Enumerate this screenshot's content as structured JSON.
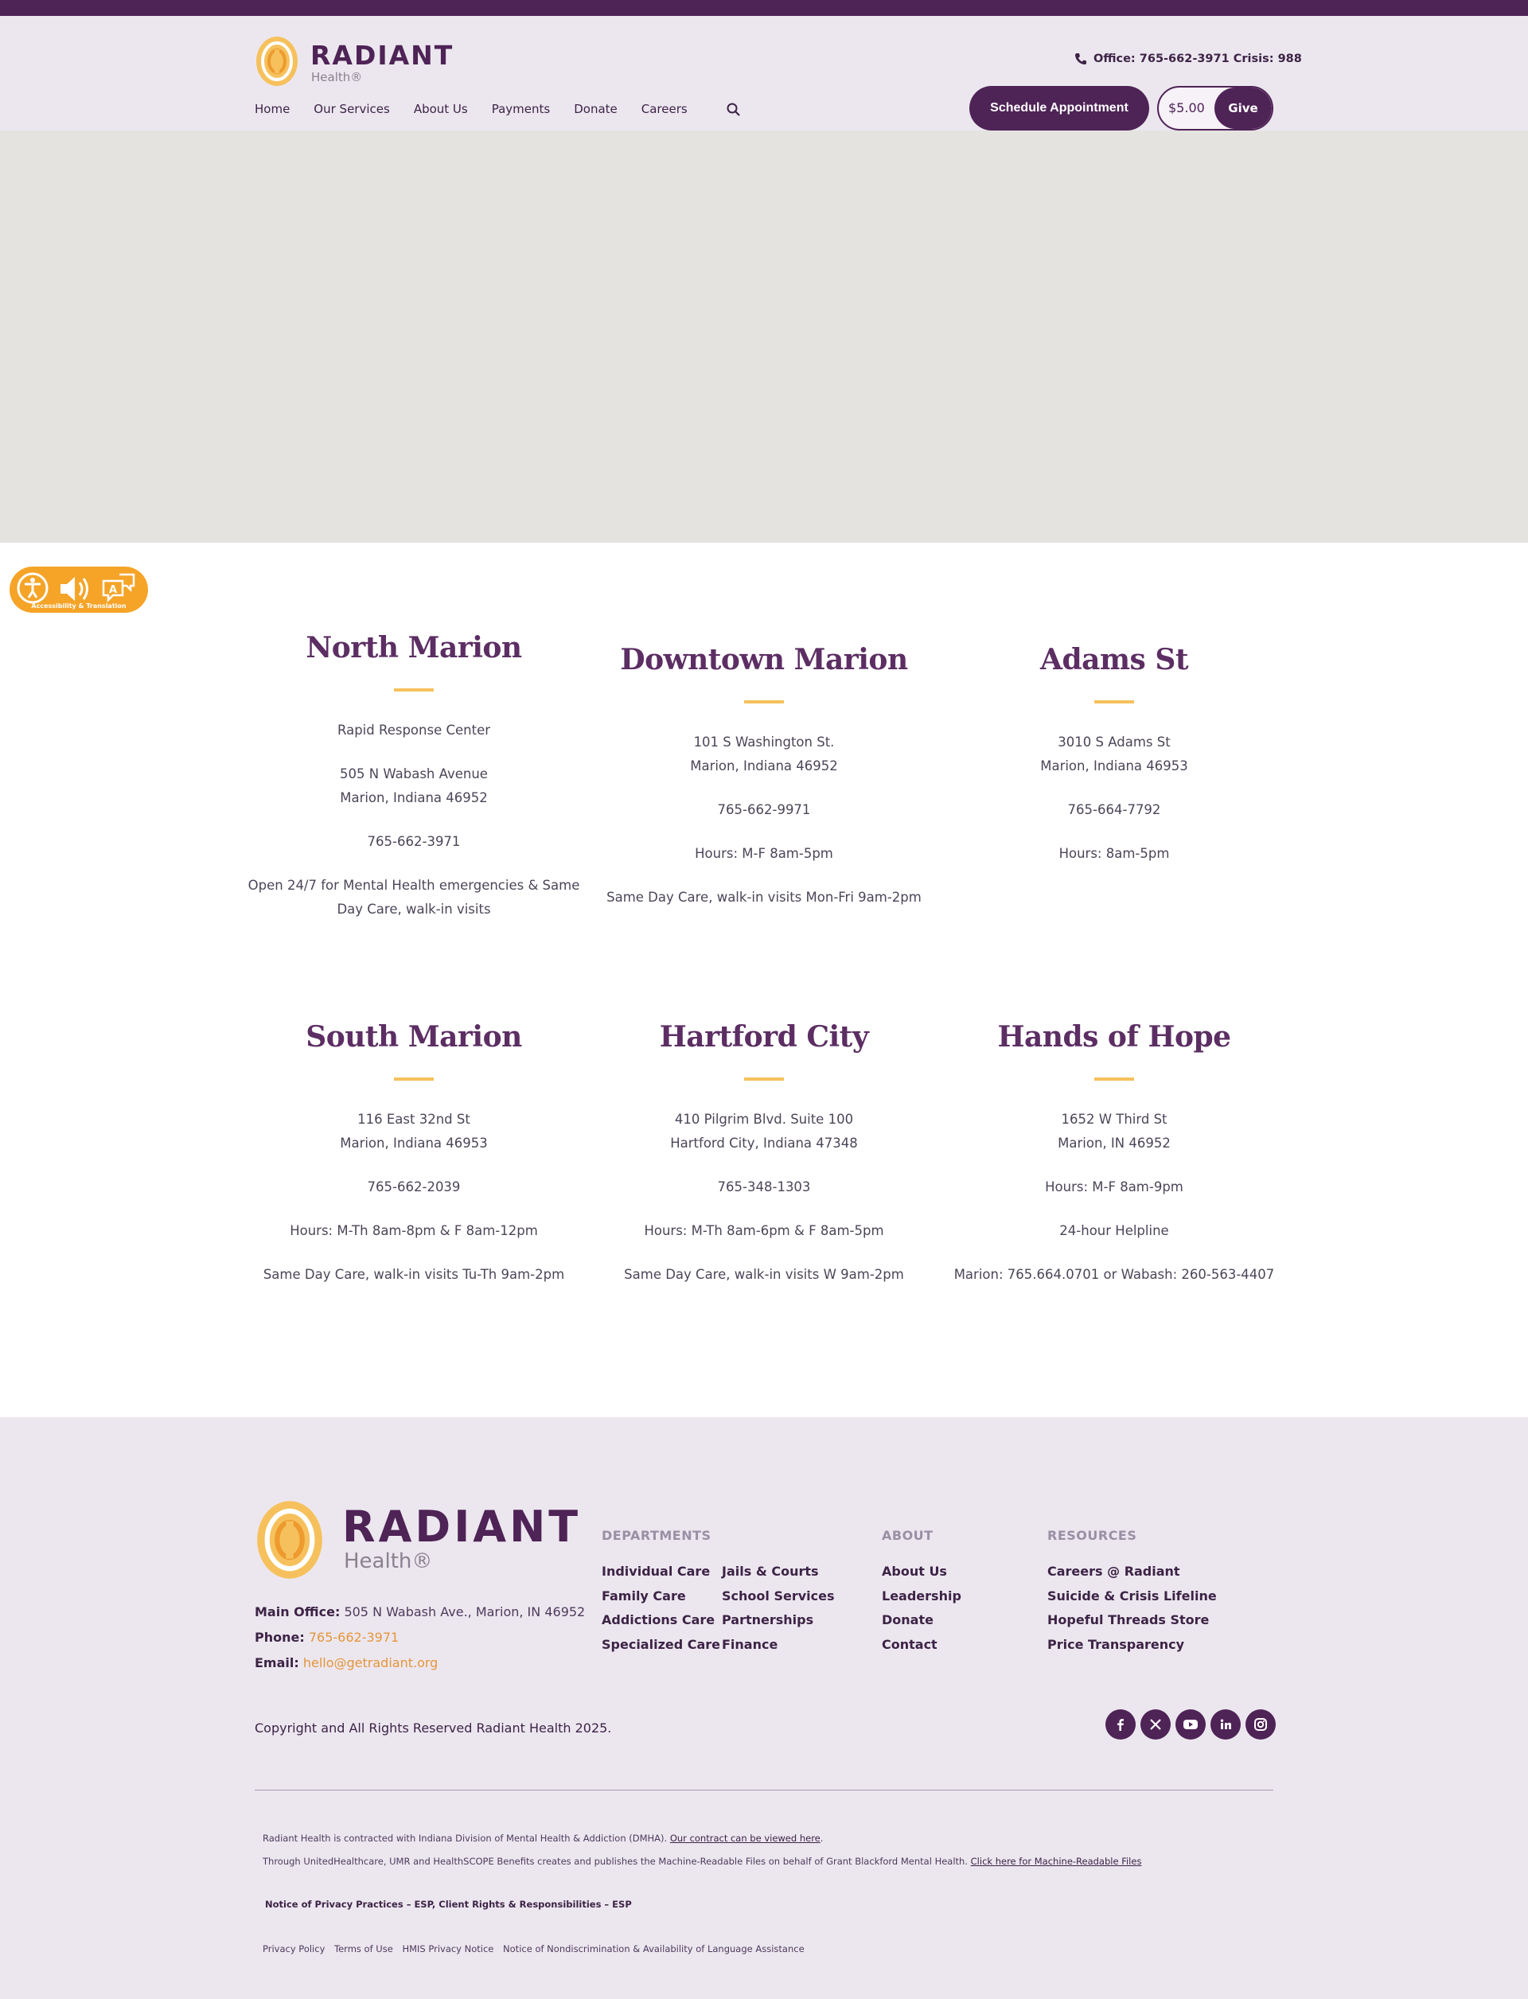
{
  "header": {
    "logo_word": "RADIANT",
    "logo_sub": "Health®",
    "office_text": "Office: 765-662-3971 Crisis: 988",
    "nav": [
      "Home",
      "Our Services",
      "About Us",
      "Payments",
      "Donate",
      "Careers"
    ],
    "schedule_label": "Schedule Appointment",
    "give_amount": "$5.00",
    "give_label": "Give"
  },
  "accessibility": {
    "caption": "Accessibility & Translation"
  },
  "locations": [
    {
      "name": "North Marion",
      "lines": [
        "Rapid Response Center",
        "",
        "505 N Wabash Avenue",
        "Marion, Indiana 46952",
        "",
        "765-662-3971",
        "",
        "Open 24/7 for Mental Health emergencies & Same",
        "Day Care, walk-in visits"
      ]
    },
    {
      "name": "Downtown Marion",
      "lines": [
        "101 S Washington St.",
        "Marion, Indiana 46952",
        "",
        "765-662-9971",
        "",
        "Hours: M-F 8am-5pm",
        "",
        "Same Day Care, walk-in visits Mon-Fri 9am-2pm"
      ]
    },
    {
      "name": "Adams St",
      "lines": [
        "3010 S Adams St",
        "Marion, Indiana 46953",
        "",
        "765-664-7792",
        "",
        "Hours: 8am-5pm"
      ]
    },
    {
      "name": "South Marion",
      "lines": [
        "116 East 32nd St",
        "Marion, Indiana 46953",
        "",
        "765-662-2039",
        "",
        "Hours: M-Th 8am-8pm & F 8am-12pm",
        "",
        "Same Day Care, walk-in visits Tu-Th 9am-2pm"
      ]
    },
    {
      "name": "Hartford City",
      "lines": [
        "410 Pilgrim Blvd. Suite 100",
        "Hartford City, Indiana 47348",
        "",
        "765-348-1303",
        "",
        "Hours: M-Th 8am-6pm & F 8am-5pm",
        "",
        "Same Day Care, walk-in visits W 9am-2pm"
      ]
    },
    {
      "name": "Hands of Hope",
      "lines": [
        "1652 W Third St",
        "Marion, IN 46952",
        "",
        "Hours: M-F 8am-9pm",
        "",
        "24-hour Helpline",
        "",
        "Marion: 765.664.0701 or Wabash: 260-563-4407"
      ]
    }
  ],
  "footer": {
    "logo_word": "RADIANT",
    "logo_sub": "Health®",
    "main_office_label": "Main Office:",
    "main_office_value": "505 N Wabash Ave., Marion, IN 46952",
    "phone_label": "Phone:",
    "phone_value": "765-662-3971",
    "email_label": "Email:",
    "email_value": "hello@getradiant.org",
    "departments_title": "DEPARTMENTS",
    "departments": [
      "Individual Care",
      "Family Care",
      "Addictions Care",
      "Specialized Care",
      "Jails & Courts",
      "School Services",
      "Partnerships",
      "Finance"
    ],
    "about_title": "ABOUT",
    "about": [
      "About Us",
      "Leadership",
      "Donate",
      "Contact"
    ],
    "resources_title": "RESOURCES",
    "resources": [
      "Careers @ Radiant",
      "Suicide & Crisis Lifeline",
      "Hopeful Threads Store",
      "Price Transparency"
    ],
    "copyright": "Copyright and All Rights Reserved Radiant Health 2025.",
    "socials": [
      "facebook-icon",
      "x-icon",
      "youtube-icon",
      "linkedin-icon",
      "instagram-icon"
    ],
    "contract_text": "Radiant Health is contracted with Indiana Division of Mental Health & Addiction (DMHA).",
    "contract_link": "Our contract can be viewed here",
    "mrf_text": "Through UnitedHealthcare, UMR and HealthSCOPE Benefits creates and publishes the Machine-Readable Files on behalf of Grant Blackford Mental Health.",
    "mrf_link": "Click here for Machine-Readable Files",
    "notices": "Notice of Privacy Practices  –  ESP,   Client Rights & Responsibilities  –  ESP",
    "legal_links": [
      "Privacy Policy",
      "Terms of Use",
      "HMIS Privacy Notice",
      "Notice of Nondiscrimination & Availability of Language Assistance"
    ]
  }
}
